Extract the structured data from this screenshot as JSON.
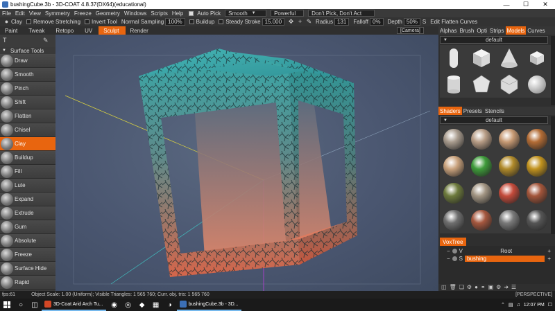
{
  "window": {
    "title": "bushingCube.3b - 3D-COAT 4.8.37(DX64)(educational)"
  },
  "menubar": {
    "items": [
      "File",
      "Edit",
      "View",
      "Symmetry",
      "Freeze",
      "Geometry",
      "Windows",
      "Scripts",
      "Help"
    ],
    "auto_pick": "Auto Pick",
    "smooth_mode": "Smooth",
    "power_mode": "Powerful",
    "pick_mode": "Don't Pick, Don't Act"
  },
  "toolbar": {
    "clay": "Clay",
    "remove_stretching": "Remove Stretching",
    "invert_tool": "Invert Tool",
    "normal_sampling": "Normal Sampling",
    "normal_sampling_value": "100%",
    "buildup": "Buildup",
    "steady_stroke": "Steady Stroke",
    "steady_stroke_value": "15.000",
    "radius": "Radius",
    "radius_value": "131",
    "falloff": "Falloff",
    "falloff_value": "0%",
    "depth": "Depth",
    "depth_value": "50%",
    "depth_extra": "S",
    "edit_flatten_curves": "Edit Flatten Curves"
  },
  "rooms": {
    "items": [
      "Paint",
      "Tweak",
      "Retopo",
      "UV",
      "Sculpt",
      "Render"
    ],
    "active": "Sculpt",
    "camera": "[Camera]"
  },
  "tools": {
    "header": "Surface Tools",
    "items": [
      "Draw",
      "Smooth",
      "Pinch",
      "Shift",
      "Flatten",
      "Chisel",
      "Clay",
      "Buildup",
      "Fill",
      "Lute",
      "Expand",
      "Extrude",
      "Gum",
      "Absolute",
      "Freeze",
      "Surface Hide",
      "Rapid"
    ],
    "active": "Clay"
  },
  "right_panel": {
    "top_tabs": [
      "Alphas",
      "Brush",
      "Opti",
      "Strips",
      "Models",
      "Curves"
    ],
    "top_active": "Models",
    "models_preset": "default",
    "shader_tabs": [
      "Shaders",
      "Presets",
      "Stencils"
    ],
    "shader_active": "Shaders",
    "shaders_preset": "default",
    "shader_colors": [
      "#a99c8e",
      "#b89d86",
      "#c79a74",
      "#b36c35",
      "#c9a27c",
      "#3e9b3a",
      "#b08a2a",
      "#c2931e",
      "#6d7a3c",
      "#a29583",
      "#c44a3a",
      "#a3553a",
      "#6f6f6f",
      "#a5573e",
      "#7a7a7a",
      "#555555"
    ],
    "voxtree_title": "VoxTree",
    "voxtree_items": [
      {
        "flag": "V",
        "name": "Root"
      },
      {
        "flag": "S",
        "name": "bushing"
      }
    ],
    "voxtree_active": "bushing"
  },
  "status": {
    "fps": "fps:61",
    "stats": "Object Scale: 1.00 (Uniform); Visible Triangles: 1 565 760; Curr. obj. tris: 1 565 760",
    "view_mode": "[PERSPECTIVE]"
  },
  "taskbar": {
    "apps": [
      {
        "label": "3D-Coat Arid Arch Tu...",
        "color": "#d24726"
      },
      {
        "label": "bushingCube.3b - 3D...",
        "color": "#3b6fb6"
      }
    ],
    "time": "12:07 PM"
  },
  "colors": {
    "accent": "#e8650f",
    "viewport_bg": "#4a5670",
    "cube_top": "#3aa6a6",
    "cube_bottom": "#d5654a"
  }
}
